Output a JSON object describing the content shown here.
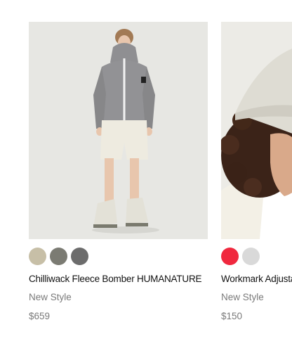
{
  "products": [
    {
      "name": "Chilliwack Fleece Bomber HUMANATURE",
      "style_label": "New Style",
      "price": "$659",
      "swatches": [
        "#c7bfa7",
        "#7b7b73",
        "#6c6c6c"
      ]
    },
    {
      "name": "Workmark Adjustable",
      "style_label": "New Style",
      "price": "$150",
      "swatches": [
        "#f0283e",
        "#d9d9d9"
      ]
    }
  ]
}
